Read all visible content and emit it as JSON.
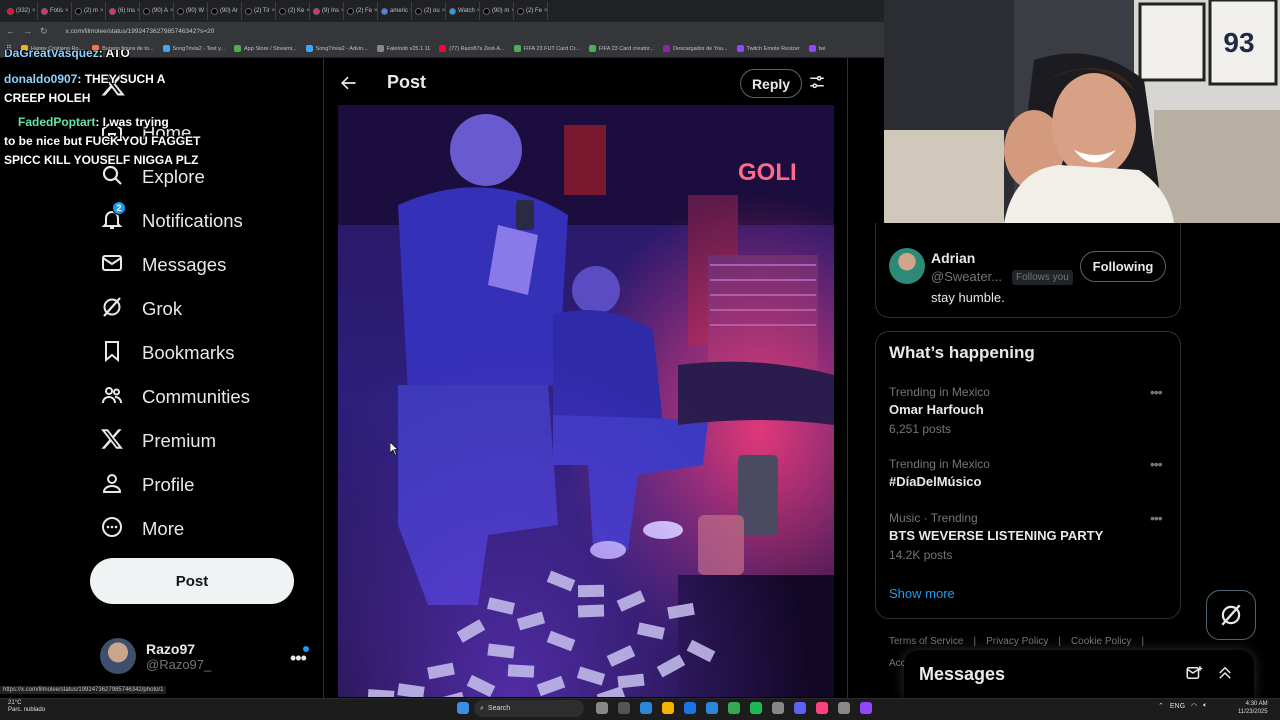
{
  "browser": {
    "tabs": [
      "(332)",
      "Fotis",
      "(2) m",
      "(6) Ins",
      "(90) A",
      "(90) W",
      "(90) Ar",
      "(2) Tir",
      "(2) Ke",
      "(9) Ins",
      "(2) Fe",
      "americ",
      "(2) ou",
      "Watch",
      "(90) m",
      "(2) Fe"
    ],
    "url": "x.com/lilmolee/status/1992473627985746342?s=20",
    "bookmarks": [
      "Happy Cristiano Ro...",
      "Burago figura de to...",
      "SongTrivia2 - Test y...",
      "App Store / Streami...",
      "SongTrivia2 - Advin...",
      "Faletoob v25.1.11",
      "(77) Razo87s Zest-A...",
      "FIFA 23 FUT Card Cr...",
      "FIFA 23 Card creator...",
      "Descargador de You...",
      "Twitch Emote Resizer",
      "twi"
    ],
    "status_url": "https://x.com/lilmolee/status/1992473627985746342/photo/1"
  },
  "chat": [
    {
      "user": "DaGreatVasquez",
      "text": ": ATO"
    },
    {
      "user": "donaldo0907",
      "text": ": THEY SUCH A"
    },
    {
      "user": "",
      "text": "CREEP HOLEH"
    },
    {
      "user": "FadedPoptart",
      "text": ": I was trying"
    },
    {
      "user": "",
      "text": "to be nice but FUCK YOU FAGGET"
    },
    {
      "user": "",
      "text": "SPICC KILL YOUSELF NIGGA PLZ"
    }
  ],
  "sidebar": {
    "items": [
      {
        "label": "Home",
        "icon": "home-icon"
      },
      {
        "label": "Explore",
        "icon": "search-icon"
      },
      {
        "label": "Notifications",
        "icon": "bell-icon",
        "badge": "2"
      },
      {
        "label": "Messages",
        "icon": "envelope-icon"
      },
      {
        "label": "Grok",
        "icon": "grok-icon"
      },
      {
        "label": "Bookmarks",
        "icon": "bookmark-icon"
      },
      {
        "label": "Communities",
        "icon": "communities-icon"
      },
      {
        "label": "Premium",
        "icon": "x-logo-icon"
      },
      {
        "label": "Profile",
        "icon": "person-icon"
      },
      {
        "label": "More",
        "icon": "more-circle-icon"
      }
    ],
    "post_button": "Post",
    "account": {
      "name": "Razo97",
      "handle": "@Razo97_"
    }
  },
  "post_header": {
    "title": "Post",
    "reply": "Reply"
  },
  "photo": {
    "sign_text": "GOLI"
  },
  "who_to_follow": {
    "name": "Adrian",
    "handle": "@Sweater...",
    "follows_you": "Follows you",
    "bio": "stay humble.",
    "button": "Following"
  },
  "trends": {
    "title": "What’s happening",
    "items": [
      {
        "context": "Trending in Mexico",
        "name": "Omar Harfouch",
        "count": "6,251 posts"
      },
      {
        "context": "Trending in Mexico",
        "name": "#DíaDelMúsico",
        "count": ""
      },
      {
        "context": "Music · Trending",
        "name": "BTS WEVERSE LISTENING PARTY",
        "count": "14.2K posts"
      }
    ],
    "show_more": "Show more"
  },
  "footer": {
    "links": [
      "Terms of Service",
      "|",
      "Privacy Policy",
      "|",
      "Cookie Policy",
      "|"
    ],
    "acc": "Acc"
  },
  "messages_drawer": {
    "title": "Messages"
  },
  "taskbar": {
    "weather_temp": "21°C",
    "weather_desc": "Parc. nublado",
    "search": "Search",
    "lang": "ENG",
    "time": "4:30 AM",
    "date": "11/23/2025"
  },
  "colors": {
    "accent": "#1d9bf0",
    "background": "#000000",
    "text": "#e7e9ea",
    "muted": "#71767b",
    "border": "#2f3336"
  }
}
